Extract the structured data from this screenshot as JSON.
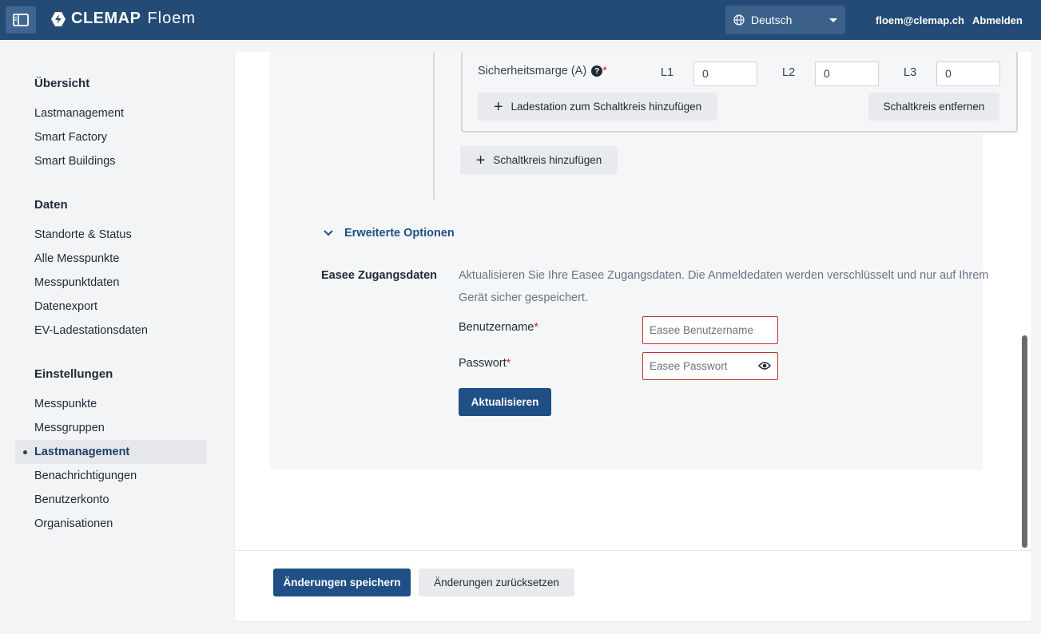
{
  "header": {
    "brand": "CLEMAP",
    "product": "Floem",
    "language": "Deutsch",
    "user_email": "floem@clemap.ch",
    "logout_label": "Abmelden"
  },
  "sidebar": {
    "section_overview": "Übersicht",
    "overview_items": [
      "Lastmanagement",
      "Smart Factory",
      "Smart Buildings"
    ],
    "section_data": "Daten",
    "data_items": [
      "Standorte & Status",
      "Alle Messpunkte",
      "Messpunktdaten",
      "Datenexport",
      "EV-Ladestationsdaten"
    ],
    "section_settings": "Einstellungen",
    "settings_items": [
      "Messpunkte",
      "Messgruppen",
      "Lastmanagement",
      "Benachrichtigungen",
      "Benutzerkonto",
      "Organisationen"
    ],
    "active_item": "Lastmanagement"
  },
  "circuit": {
    "safety_margin_label": "Sicherheitsmarge (A)",
    "required_mark": "*",
    "help_icon": "?",
    "l1_label": "L1",
    "l1_value": "0",
    "l2_label": "L2",
    "l2_value": "0",
    "l3_label": "L3",
    "l3_value": "0",
    "add_station_label": "Ladestation zum Schaltkreis hinzufügen",
    "remove_circuit_label": "Schaltkreis entfernen",
    "add_circuit_label": "Schaltkreis hinzufügen"
  },
  "advanced": {
    "toggle_label": "Erweiterte Optionen",
    "easee_title": "Easee Zugangsdaten",
    "easee_description": "Aktualisieren Sie Ihre Easee Zugangsdaten. Die Anmeldedaten werden verschlüsselt und nur auf Ihrem Gerät sicher gespeichert.",
    "username_label": "Benutzername",
    "username_placeholder": "Easee Benutzername",
    "password_label": "Passwort",
    "password_placeholder": "Easee Passwort",
    "update_label": "Aktualisieren"
  },
  "footer": {
    "save_label": "Änderungen speichern",
    "reset_label": "Änderungen zurücksetzen"
  },
  "colors": {
    "header_bg": "#244b76",
    "primary": "#1f4f85",
    "error_border": "#c53030"
  }
}
